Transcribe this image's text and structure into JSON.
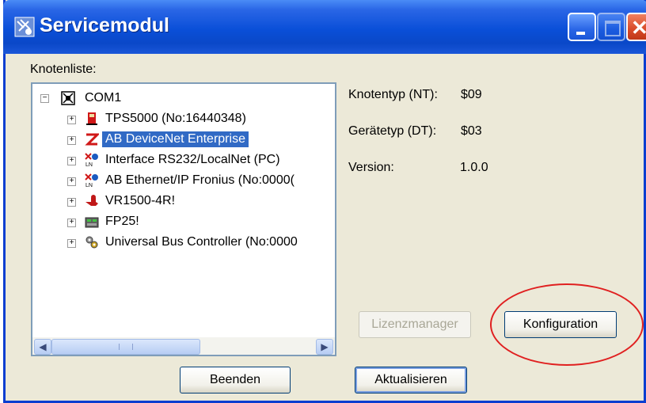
{
  "window": {
    "title": "Servicemodul"
  },
  "tree": {
    "label": "Knotenliste:",
    "root": "COM1",
    "items": [
      {
        "label": "TPS5000 (No:16440348)",
        "icon": "power-source-icon"
      },
      {
        "label": "AB DeviceNet Enterprise",
        "icon": "devicenet-icon",
        "selected": true
      },
      {
        "label": "Interface RS232/LocalNet (PC)",
        "icon": "localnet-interface-icon"
      },
      {
        "label": "AB Ethernet/IP Fronius (No:0000(",
        "icon": "localnet-interface-icon"
      },
      {
        "label": "VR1500-4R!",
        "icon": "wire-feeder-icon"
      },
      {
        "label": "FP25!",
        "icon": "panel-icon"
      },
      {
        "label": "Universal Bus Controller (No:0000",
        "icon": "bus-controller-icon"
      }
    ]
  },
  "details": {
    "node_type_label": "Knotentyp (NT):",
    "node_type_value": "$09",
    "device_type_label": "Gerätetyp (DT):",
    "device_type_value": "$03",
    "version_label": "Version:",
    "version_value": "1.0.0"
  },
  "buttons": {
    "license": "Lizenzmanager",
    "config": "Konfiguration",
    "quit": "Beenden",
    "refresh": "Aktualisieren"
  },
  "colors": {
    "titlebar": "#0a4fd8",
    "selection": "#316ac5",
    "highlight_ellipse": "#e02020"
  }
}
